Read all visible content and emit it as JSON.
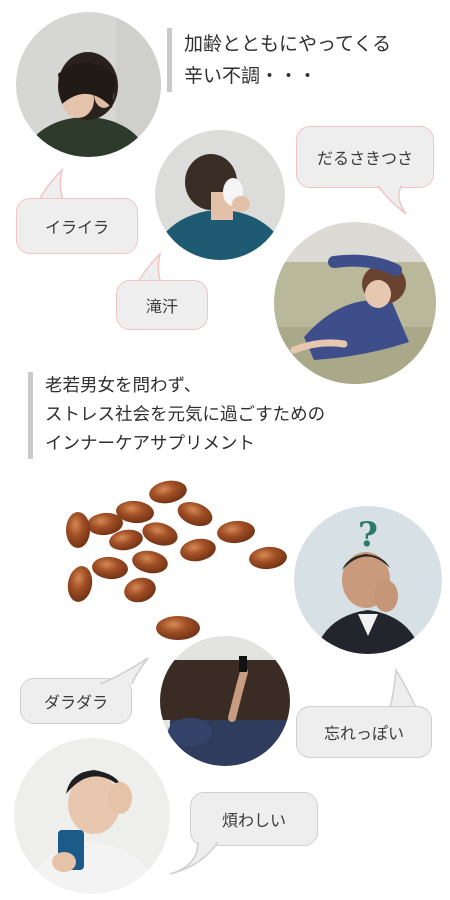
{
  "heading_top": {
    "line1": "加齢とともにやってくる",
    "line2": "辛い不調・・・"
  },
  "heading_mid": {
    "line1": "老若男女を問わず、",
    "line2": "ストレス社会を元気に過ごすための",
    "line3": "インナーケアサプリメント"
  },
  "bubbles": {
    "irritation": "イライラ",
    "sweat": "滝汗",
    "fatigue": "だるさきつさ",
    "lazy": "ダラダラ",
    "forgetful": "忘れっぽい",
    "annoying": "煩わしい"
  },
  "decor": {
    "question_mark": "?"
  },
  "colors": {
    "pink_border": "#f2c4c4",
    "gray_border": "#cfcfcf",
    "bubble_fill": "#eeeeee",
    "capsule": "#9a4a22",
    "heading_bar": "#c9c9c9"
  }
}
